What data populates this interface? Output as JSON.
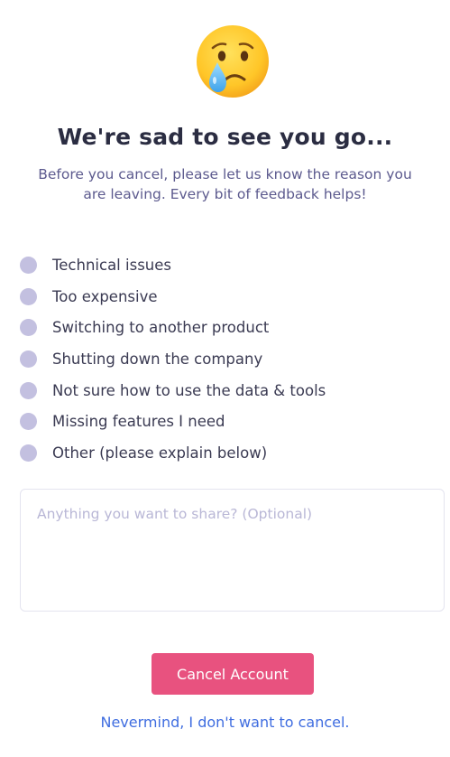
{
  "header": {
    "emoji_icon": "crying-face-icon",
    "title": "We're sad to see you go...",
    "subtitle": "Before you cancel, please let us know the reason you are leaving. Every bit of feedback helps!"
  },
  "reasons": [
    {
      "label": "Technical issues",
      "selected": false
    },
    {
      "label": "Too expensive",
      "selected": false
    },
    {
      "label": "Switching to another product",
      "selected": false
    },
    {
      "label": "Shutting down the company",
      "selected": false
    },
    {
      "label": "Not sure how to use the data & tools",
      "selected": false
    },
    {
      "label": "Missing features I need",
      "selected": false
    },
    {
      "label": "Other (please explain below)",
      "selected": false
    }
  ],
  "feedback": {
    "placeholder": "Anything you want to share? (Optional)",
    "value": ""
  },
  "actions": {
    "cancel_label": "Cancel Account",
    "nevermind_label": "Nevermind, I don't want to cancel."
  },
  "colors": {
    "title": "#2b2d42",
    "subtitle": "#5c5a8e",
    "radio": "#c3c0e0",
    "cancel_button": "#e8527f",
    "link": "#3f6de0",
    "placeholder": "#b9b7d6"
  }
}
